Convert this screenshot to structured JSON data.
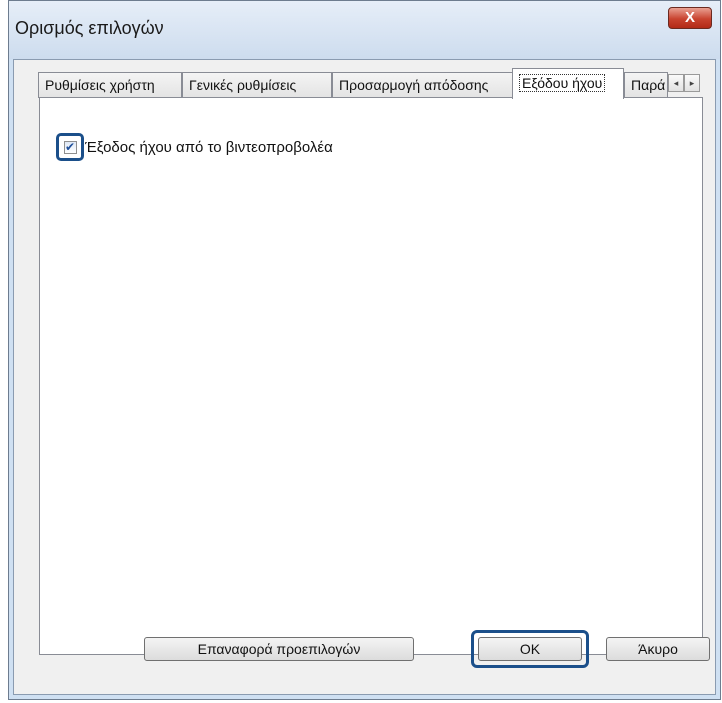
{
  "window": {
    "title": "Ορισμός επιλογών",
    "close_glyph": "X"
  },
  "tabs": [
    {
      "label": "Ρυθμίσεις χρήστη",
      "active": false
    },
    {
      "label": "Γενικές ρυθμίσεις",
      "active": false
    },
    {
      "label": "Προσαρμογή απόδοσης",
      "active": false
    },
    {
      "label": "Εξόδου ήχου",
      "active": true
    },
    {
      "label": "Παρά",
      "active": false
    }
  ],
  "tab_scroll": {
    "left": "◂",
    "right": "▸"
  },
  "audio_output": {
    "checkbox_label": "Έξοδος ήχου από το βιντεοπροβολέα",
    "checked": true,
    "check_glyph": "✔"
  },
  "buttons": {
    "reset": "Επαναφορά προεπιλογών",
    "ok": "OK",
    "cancel": "Άκυρο"
  },
  "colors": {
    "highlight": "#1b4f8a",
    "title_bar": "#cddcee",
    "close": "#c8432f"
  }
}
